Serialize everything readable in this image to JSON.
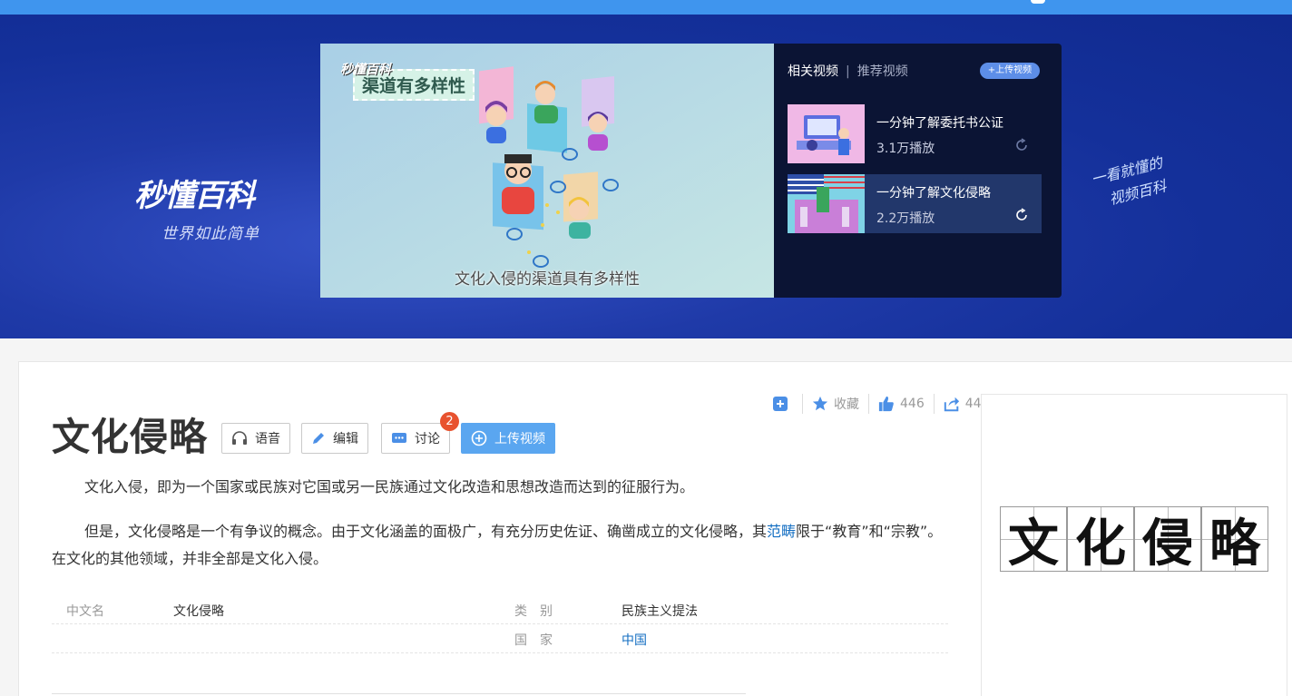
{
  "banner": {
    "logo": "秒懂百科",
    "slogan": "世界如此简单",
    "handwriting_line1": "一看就懂的",
    "handwriting_line2": "视频百科"
  },
  "player": {
    "logo": "秒懂百科",
    "tag": "渠道有多样性",
    "subtitle": "文化入侵的渠道具有多样性"
  },
  "related": {
    "tab_related": "相关视频",
    "tab_recommended": "推荐视频",
    "upload_label": "+上传视频",
    "items": [
      {
        "title": "一分钟了解委托书公证",
        "plays": "3.1万播放"
      },
      {
        "title": "一分钟了解文化侵略",
        "plays": "2.2万播放"
      }
    ]
  },
  "toolbar": {
    "collect_label": "收藏",
    "like_count": "446",
    "share_count": "44"
  },
  "entry": {
    "title": "文化侵略",
    "buttons": {
      "voice": "语音",
      "edit": "编辑",
      "discuss": "讨论",
      "discuss_badge": "2",
      "upload_video": "上传视频"
    },
    "para1": "文化入侵，即为一个国家或民族对它国或另一民族通过文化改造和思想改造而达到的征服行为。",
    "para2_before": "但是，文化侵略是一个有争议的概念。由于文化涵盖的面极广，有充分历史佐证、确凿成立的文化侵略，其",
    "para2_link": "范畴",
    "para2_after": "限于“教育”和“宗教”。在文化的其他领域，并非全部是文化入侵。"
  },
  "basic_info": {
    "rows": [
      {
        "label1": "中文名",
        "value1": "文化侵略",
        "label2": "类　别",
        "value2": "民族主义提法"
      },
      {
        "label1": "",
        "value1": "",
        "label2": "国　家",
        "value2": "中国"
      }
    ]
  },
  "side_image": {
    "characters": [
      "文",
      "化",
      "侵",
      "略"
    ]
  }
}
